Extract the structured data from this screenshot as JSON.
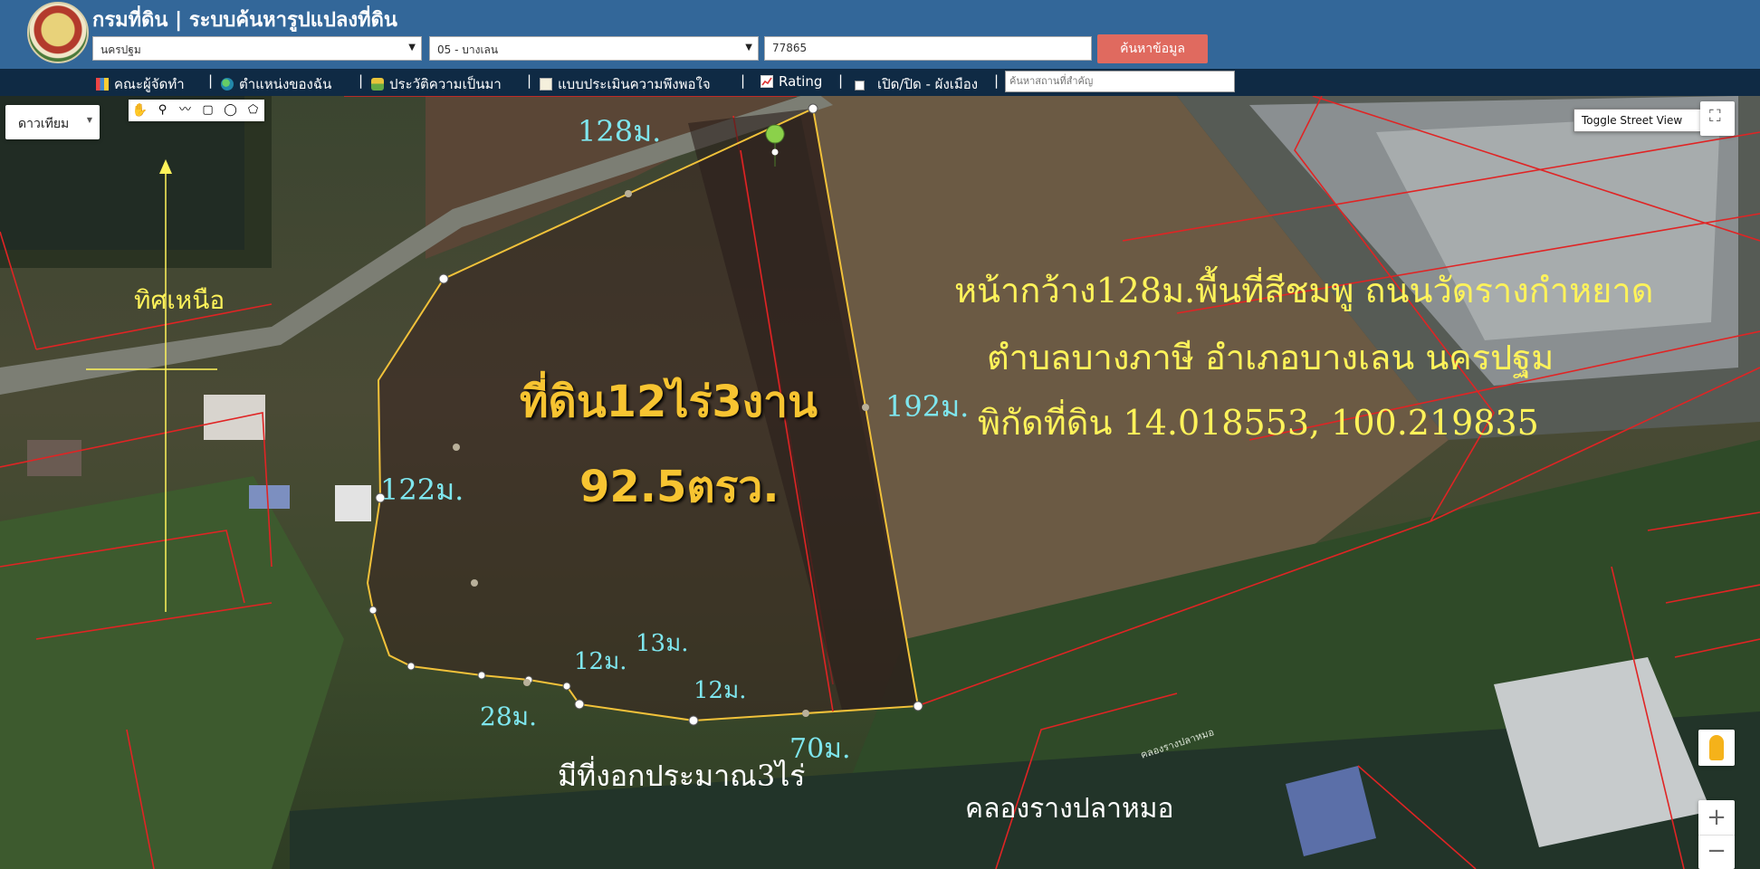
{
  "header": {
    "title": "กรมที่ดิน | ระบบค้นหารูปแปลงที่ดิน",
    "province": "นครปฐม",
    "district": "05 - บางเลน",
    "parcel_no": "77865",
    "search_button": "ค้นหาข้อมูล"
  },
  "nav": {
    "items": [
      {
        "label": "คณะผู้จัดทำ",
        "icon": "team-icon"
      },
      {
        "label": "ตำแหน่งของฉัน",
        "icon": "globe-icon"
      },
      {
        "label": "ประวัติความเป็นมา",
        "icon": "history-icon"
      },
      {
        "label": "แบบประเมินความพึงพอใจ",
        "icon": "form-icon"
      },
      {
        "label": "Rating",
        "icon": "chart-icon"
      },
      {
        "label": "เปิด/ปิด - ผังเมือง",
        "icon": "checkbox-icon"
      }
    ],
    "separator": "|",
    "place_search_placeholder": "ค้นหาสถานที่สำคัญ"
  },
  "map": {
    "map_type": "ดาวเทียม",
    "street_view_button": "Toggle Street View",
    "zoom_in": "+",
    "zoom_out": "−",
    "north_label": "ทิศเหนือ",
    "measurements": {
      "top": "128ม.",
      "right": "192ม.",
      "left": "122ม.",
      "bottom_left": "28ม.",
      "bottom_a": "12ม.",
      "bottom_b": "13ม.",
      "bottom_c": "12ม.",
      "bottom": "70ม."
    },
    "land_title": "ที่ดิน12ไร่3งาน",
    "land_area": "92.5ตรว.",
    "desc_line1": "หน้ากว้าง128ม.พื้นที่สีชมพู ถนนวัดรางกำหยาด",
    "desc_line2": "ตำบลบางภาษี อำเภอบางเลน นครปฐม",
    "desc_line3": "พิกัดที่ดิน 14.018553, 100.219835",
    "extra_land_note": "มีที่งอกประมาณ3ไร่",
    "canal_label": "คลองรางปลาหมอ",
    "canal_small_label": "คลองรางปลาหมอ"
  }
}
